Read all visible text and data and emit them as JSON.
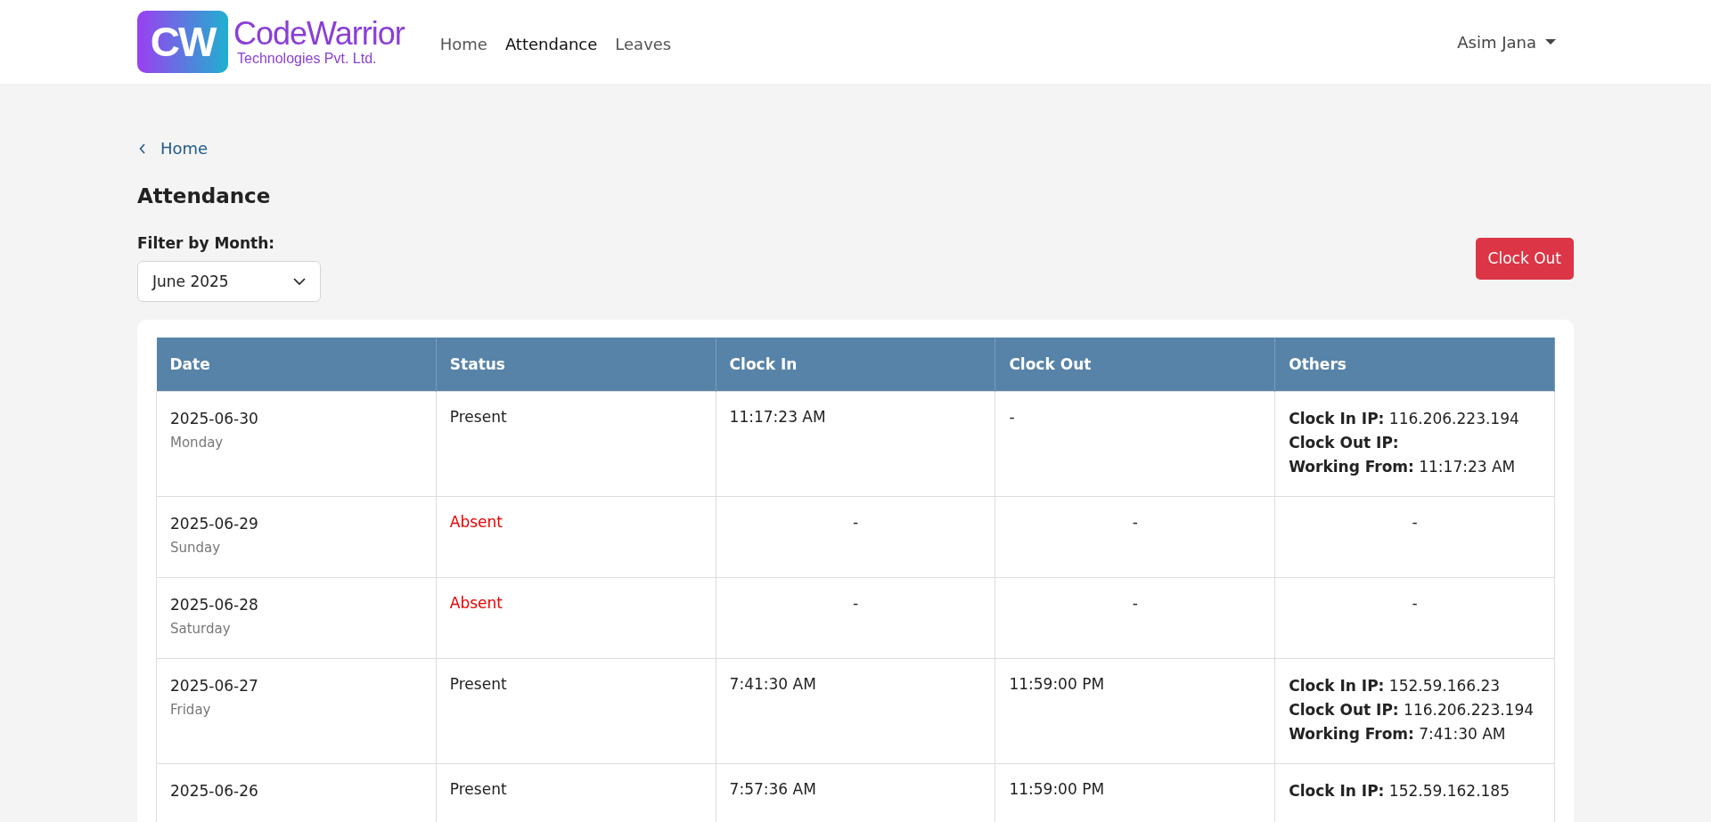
{
  "header": {
    "logo": {
      "mark": "CW",
      "name": "CodeWarrior",
      "tagline": "Technologies Pvt. Ltd."
    },
    "nav": [
      {
        "label": "Home",
        "selected": false
      },
      {
        "label": "Attendance",
        "selected": true
      },
      {
        "label": "Leaves",
        "selected": false
      }
    ],
    "user": {
      "name": "Asim Jana"
    }
  },
  "breadcrumb": {
    "label": "Home"
  },
  "title": "Attendance",
  "filter": {
    "label": "Filter by Month:",
    "value": "June 2025"
  },
  "clock_out_button": "Clock Out",
  "table": {
    "columns": [
      "Date",
      "Status",
      "Clock In",
      "Clock Out",
      "Others"
    ],
    "rows": [
      {
        "kind": "present",
        "date": "2025-06-30",
        "day": "Monday",
        "status": "Present",
        "clock_in": "11:17:23 AM",
        "clock_out": "-",
        "others": [
          {
            "label": "Clock In IP:",
            "value": "116.206.223.194"
          },
          {
            "label": "Clock Out IP:"
          },
          {
            "label": "Working From:",
            "value": "11:17:23 AM"
          }
        ]
      },
      {
        "kind": "absent",
        "date": "2025-06-29",
        "day": "Sunday",
        "status": "Absent",
        "clock_in": "-",
        "clock_out": "-",
        "others_text": "-"
      },
      {
        "kind": "absent",
        "date": "2025-06-28",
        "day": "Saturday",
        "status": "Absent",
        "clock_in": "-",
        "clock_out": "-",
        "others_text": "-"
      },
      {
        "kind": "present",
        "date": "2025-06-27",
        "day": "Friday",
        "status": "Present",
        "clock_in": "7:41:30 AM",
        "clock_out": "11:59:00 PM",
        "others": [
          {
            "label": "Clock In IP:",
            "value": "152.59.166.23"
          },
          {
            "label": "Clock Out IP:",
            "value": "116.206.223.194"
          },
          {
            "label": "Working From:",
            "value": "7:41:30 AM"
          }
        ]
      },
      {
        "kind": "present",
        "date": "2025-06-26",
        "status": "Present",
        "clock_in": "7:57:36 AM",
        "clock_out": "11:59:00 PM",
        "others": [
          {
            "label": "Clock In IP:",
            "value": "152.59.162.185"
          }
        ]
      }
    ]
  }
}
